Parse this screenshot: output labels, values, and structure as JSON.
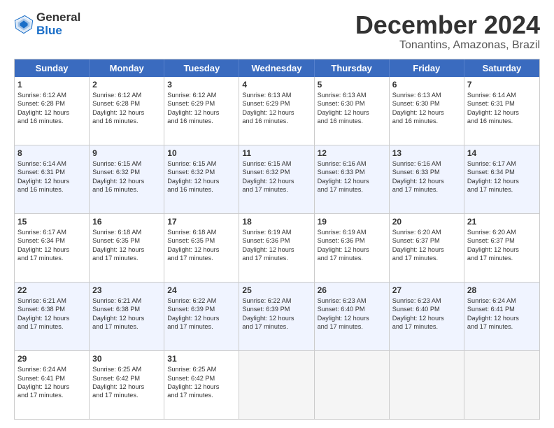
{
  "logo": {
    "line1": "General",
    "line2": "Blue"
  },
  "title": "December 2024",
  "subtitle": "Tonantins, Amazonas, Brazil",
  "header_days": [
    "Sunday",
    "Monday",
    "Tuesday",
    "Wednesday",
    "Thursday",
    "Friday",
    "Saturday"
  ],
  "weeks": [
    {
      "alt": false,
      "cells": [
        {
          "day": "1",
          "lines": [
            "Sunrise: 6:12 AM",
            "Sunset: 6:28 PM",
            "Daylight: 12 hours",
            "and 16 minutes."
          ]
        },
        {
          "day": "2",
          "lines": [
            "Sunrise: 6:12 AM",
            "Sunset: 6:28 PM",
            "Daylight: 12 hours",
            "and 16 minutes."
          ]
        },
        {
          "day": "3",
          "lines": [
            "Sunrise: 6:12 AM",
            "Sunset: 6:29 PM",
            "Daylight: 12 hours",
            "and 16 minutes."
          ]
        },
        {
          "day": "4",
          "lines": [
            "Sunrise: 6:13 AM",
            "Sunset: 6:29 PM",
            "Daylight: 12 hours",
            "and 16 minutes."
          ]
        },
        {
          "day": "5",
          "lines": [
            "Sunrise: 6:13 AM",
            "Sunset: 6:30 PM",
            "Daylight: 12 hours",
            "and 16 minutes."
          ]
        },
        {
          "day": "6",
          "lines": [
            "Sunrise: 6:13 AM",
            "Sunset: 6:30 PM",
            "Daylight: 12 hours",
            "and 16 minutes."
          ]
        },
        {
          "day": "7",
          "lines": [
            "Sunrise: 6:14 AM",
            "Sunset: 6:31 PM",
            "Daylight: 12 hours",
            "and 16 minutes."
          ]
        }
      ]
    },
    {
      "alt": true,
      "cells": [
        {
          "day": "8",
          "lines": [
            "Sunrise: 6:14 AM",
            "Sunset: 6:31 PM",
            "Daylight: 12 hours",
            "and 16 minutes."
          ]
        },
        {
          "day": "9",
          "lines": [
            "Sunrise: 6:15 AM",
            "Sunset: 6:32 PM",
            "Daylight: 12 hours",
            "and 16 minutes."
          ]
        },
        {
          "day": "10",
          "lines": [
            "Sunrise: 6:15 AM",
            "Sunset: 6:32 PM",
            "Daylight: 12 hours",
            "and 16 minutes."
          ]
        },
        {
          "day": "11",
          "lines": [
            "Sunrise: 6:15 AM",
            "Sunset: 6:32 PM",
            "Daylight: 12 hours",
            "and 17 minutes."
          ]
        },
        {
          "day": "12",
          "lines": [
            "Sunrise: 6:16 AM",
            "Sunset: 6:33 PM",
            "Daylight: 12 hours",
            "and 17 minutes."
          ]
        },
        {
          "day": "13",
          "lines": [
            "Sunrise: 6:16 AM",
            "Sunset: 6:33 PM",
            "Daylight: 12 hours",
            "and 17 minutes."
          ]
        },
        {
          "day": "14",
          "lines": [
            "Sunrise: 6:17 AM",
            "Sunset: 6:34 PM",
            "Daylight: 12 hours",
            "and 17 minutes."
          ]
        }
      ]
    },
    {
      "alt": false,
      "cells": [
        {
          "day": "15",
          "lines": [
            "Sunrise: 6:17 AM",
            "Sunset: 6:34 PM",
            "Daylight: 12 hours",
            "and 17 minutes."
          ]
        },
        {
          "day": "16",
          "lines": [
            "Sunrise: 6:18 AM",
            "Sunset: 6:35 PM",
            "Daylight: 12 hours",
            "and 17 minutes."
          ]
        },
        {
          "day": "17",
          "lines": [
            "Sunrise: 6:18 AM",
            "Sunset: 6:35 PM",
            "Daylight: 12 hours",
            "and 17 minutes."
          ]
        },
        {
          "day": "18",
          "lines": [
            "Sunrise: 6:19 AM",
            "Sunset: 6:36 PM",
            "Daylight: 12 hours",
            "and 17 minutes."
          ]
        },
        {
          "day": "19",
          "lines": [
            "Sunrise: 6:19 AM",
            "Sunset: 6:36 PM",
            "Daylight: 12 hours",
            "and 17 minutes."
          ]
        },
        {
          "day": "20",
          "lines": [
            "Sunrise: 6:20 AM",
            "Sunset: 6:37 PM",
            "Daylight: 12 hours",
            "and 17 minutes."
          ]
        },
        {
          "day": "21",
          "lines": [
            "Sunrise: 6:20 AM",
            "Sunset: 6:37 PM",
            "Daylight: 12 hours",
            "and 17 minutes."
          ]
        }
      ]
    },
    {
      "alt": true,
      "cells": [
        {
          "day": "22",
          "lines": [
            "Sunrise: 6:21 AM",
            "Sunset: 6:38 PM",
            "Daylight: 12 hours",
            "and 17 minutes."
          ]
        },
        {
          "day": "23",
          "lines": [
            "Sunrise: 6:21 AM",
            "Sunset: 6:38 PM",
            "Daylight: 12 hours",
            "and 17 minutes."
          ]
        },
        {
          "day": "24",
          "lines": [
            "Sunrise: 6:22 AM",
            "Sunset: 6:39 PM",
            "Daylight: 12 hours",
            "and 17 minutes."
          ]
        },
        {
          "day": "25",
          "lines": [
            "Sunrise: 6:22 AM",
            "Sunset: 6:39 PM",
            "Daylight: 12 hours",
            "and 17 minutes."
          ]
        },
        {
          "day": "26",
          "lines": [
            "Sunrise: 6:23 AM",
            "Sunset: 6:40 PM",
            "Daylight: 12 hours",
            "and 17 minutes."
          ]
        },
        {
          "day": "27",
          "lines": [
            "Sunrise: 6:23 AM",
            "Sunset: 6:40 PM",
            "Daylight: 12 hours",
            "and 17 minutes."
          ]
        },
        {
          "day": "28",
          "lines": [
            "Sunrise: 6:24 AM",
            "Sunset: 6:41 PM",
            "Daylight: 12 hours",
            "and 17 minutes."
          ]
        }
      ]
    },
    {
      "alt": false,
      "cells": [
        {
          "day": "29",
          "lines": [
            "Sunrise: 6:24 AM",
            "Sunset: 6:41 PM",
            "Daylight: 12 hours",
            "and 17 minutes."
          ]
        },
        {
          "day": "30",
          "lines": [
            "Sunrise: 6:25 AM",
            "Sunset: 6:42 PM",
            "Daylight: 12 hours",
            "and 17 minutes."
          ]
        },
        {
          "day": "31",
          "lines": [
            "Sunrise: 6:25 AM",
            "Sunset: 6:42 PM",
            "Daylight: 12 hours",
            "and 17 minutes."
          ]
        },
        {
          "day": "",
          "lines": []
        },
        {
          "day": "",
          "lines": []
        },
        {
          "day": "",
          "lines": []
        },
        {
          "day": "",
          "lines": []
        }
      ]
    }
  ]
}
